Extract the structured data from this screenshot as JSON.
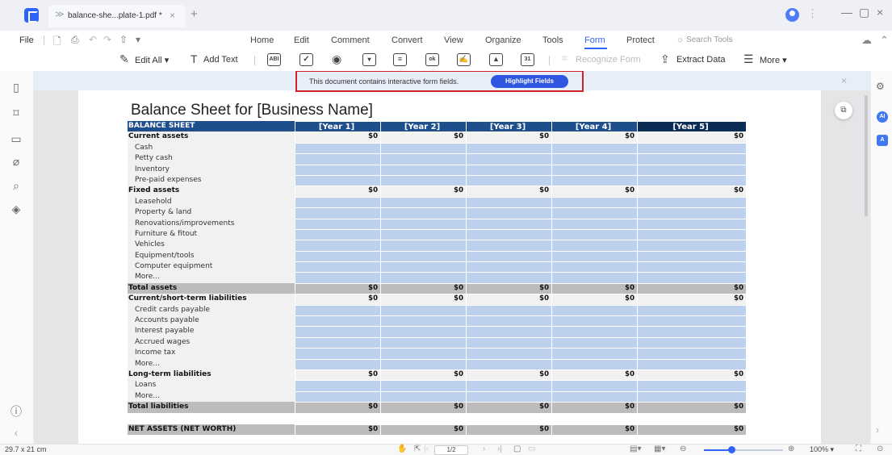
{
  "titlebar": {
    "tab_title": "balance-she...plate-1.pdf *",
    "tab_close": "×",
    "new_tab": "+",
    "kebab": "⋮",
    "minimize": "—",
    "maximize": "▢",
    "close": "×"
  },
  "menubar": {
    "file": "File",
    "items": [
      "Home",
      "Edit",
      "Comment",
      "Convert",
      "View",
      "Organize",
      "Tools",
      "Form",
      "Protect"
    ],
    "active": "Form",
    "search_placeholder": "Search Tools"
  },
  "toolbar": {
    "edit_all": "Edit All",
    "add_text": "Add Text",
    "text_field_glyph": "ABI",
    "button_glyph": "ok",
    "recognize_form": "Recognize Form",
    "extract_data": "Extract Data",
    "more": "More"
  },
  "notice": {
    "text": "This document contains interactive form fields.",
    "button": "Highlight Fields",
    "close": "×"
  },
  "sheet": {
    "title": "Balance Sheet for [Business Name]",
    "header_label": "BALANCE SHEET",
    "years": [
      "[Year 1]",
      "[Year 2]",
      "[Year 3]",
      "[Year 4]",
      "[Year 5]"
    ],
    "rows": [
      {
        "label": "Current assets",
        "kind": "section",
        "values": [
          "$0",
          "$0",
          "$0",
          "$0",
          "$0"
        ]
      },
      {
        "label": "Cash",
        "kind": "item",
        "values": []
      },
      {
        "label": "Petty cash",
        "kind": "item",
        "values": []
      },
      {
        "label": "Inventory",
        "kind": "item",
        "values": []
      },
      {
        "label": "Pre-paid expenses",
        "kind": "item",
        "values": []
      },
      {
        "label": "Fixed assets",
        "kind": "section",
        "values": [
          "$0",
          "$0",
          "$0",
          "$0",
          "$0"
        ]
      },
      {
        "label": "Leasehold",
        "kind": "item",
        "values": []
      },
      {
        "label": "Property & land",
        "kind": "item",
        "values": []
      },
      {
        "label": "Renovations/improvements",
        "kind": "item",
        "values": []
      },
      {
        "label": "Furniture & fitout",
        "kind": "item",
        "values": []
      },
      {
        "label": "Vehicles",
        "kind": "item",
        "values": []
      },
      {
        "label": "Equipment/tools",
        "kind": "item",
        "values": []
      },
      {
        "label": "Computer equipment",
        "kind": "item",
        "values": []
      },
      {
        "label": "More...",
        "kind": "item",
        "values": []
      },
      {
        "label": "Total assets",
        "kind": "total",
        "values": [
          "$0",
          "$0",
          "$0",
          "$0",
          "$0"
        ]
      },
      {
        "label": "Current/short-term liabilities",
        "kind": "section",
        "values": [
          "$0",
          "$0",
          "$0",
          "$0",
          "$0"
        ]
      },
      {
        "label": "Credit cards payable",
        "kind": "item",
        "values": []
      },
      {
        "label": "Accounts payable",
        "kind": "item",
        "values": []
      },
      {
        "label": "Interest payable",
        "kind": "item",
        "values": []
      },
      {
        "label": "Accrued wages",
        "kind": "item",
        "values": []
      },
      {
        "label": "Income tax",
        "kind": "item",
        "values": []
      },
      {
        "label": "More...",
        "kind": "item",
        "values": []
      },
      {
        "label": "Long-term liabilities",
        "kind": "section",
        "values": [
          "$0",
          "$0",
          "$0",
          "$0",
          "$0"
        ]
      },
      {
        "label": "Loans",
        "kind": "item",
        "values": []
      },
      {
        "label": "More...",
        "kind": "item",
        "values": []
      },
      {
        "label": "Total liabilities",
        "kind": "total",
        "values": [
          "$0",
          "$0",
          "$0",
          "$0",
          "$0"
        ]
      },
      {
        "label": "",
        "kind": "gap",
        "values": []
      },
      {
        "label": "NET ASSETS (NET WORTH)",
        "kind": "net",
        "values": [
          "$0",
          "$0",
          "$0",
          "$0",
          "$0"
        ]
      }
    ]
  },
  "statusbar": {
    "page_size": "29.7 x 21 cm",
    "page_indicator": "1/2",
    "zoom": "100%",
    "zoom_fraction": 0.35
  },
  "colors": {
    "accent": "#2d63f6",
    "header_blue": "#1f4e8c",
    "header_dark": "#0b2c55",
    "field_blue": "#bdd0ee",
    "total_gray": "#bcbcbc",
    "notice_outline": "#d0202a"
  },
  "icons": {
    "left_rail": [
      "page-icon",
      "bookmark-icon",
      "comment-icon",
      "attachment-icon",
      "search-icon",
      "layers-icon",
      "help-icon"
    ],
    "right_rail": [
      "properties-icon",
      "ai-assistant-icon",
      "translate-icon"
    ]
  }
}
